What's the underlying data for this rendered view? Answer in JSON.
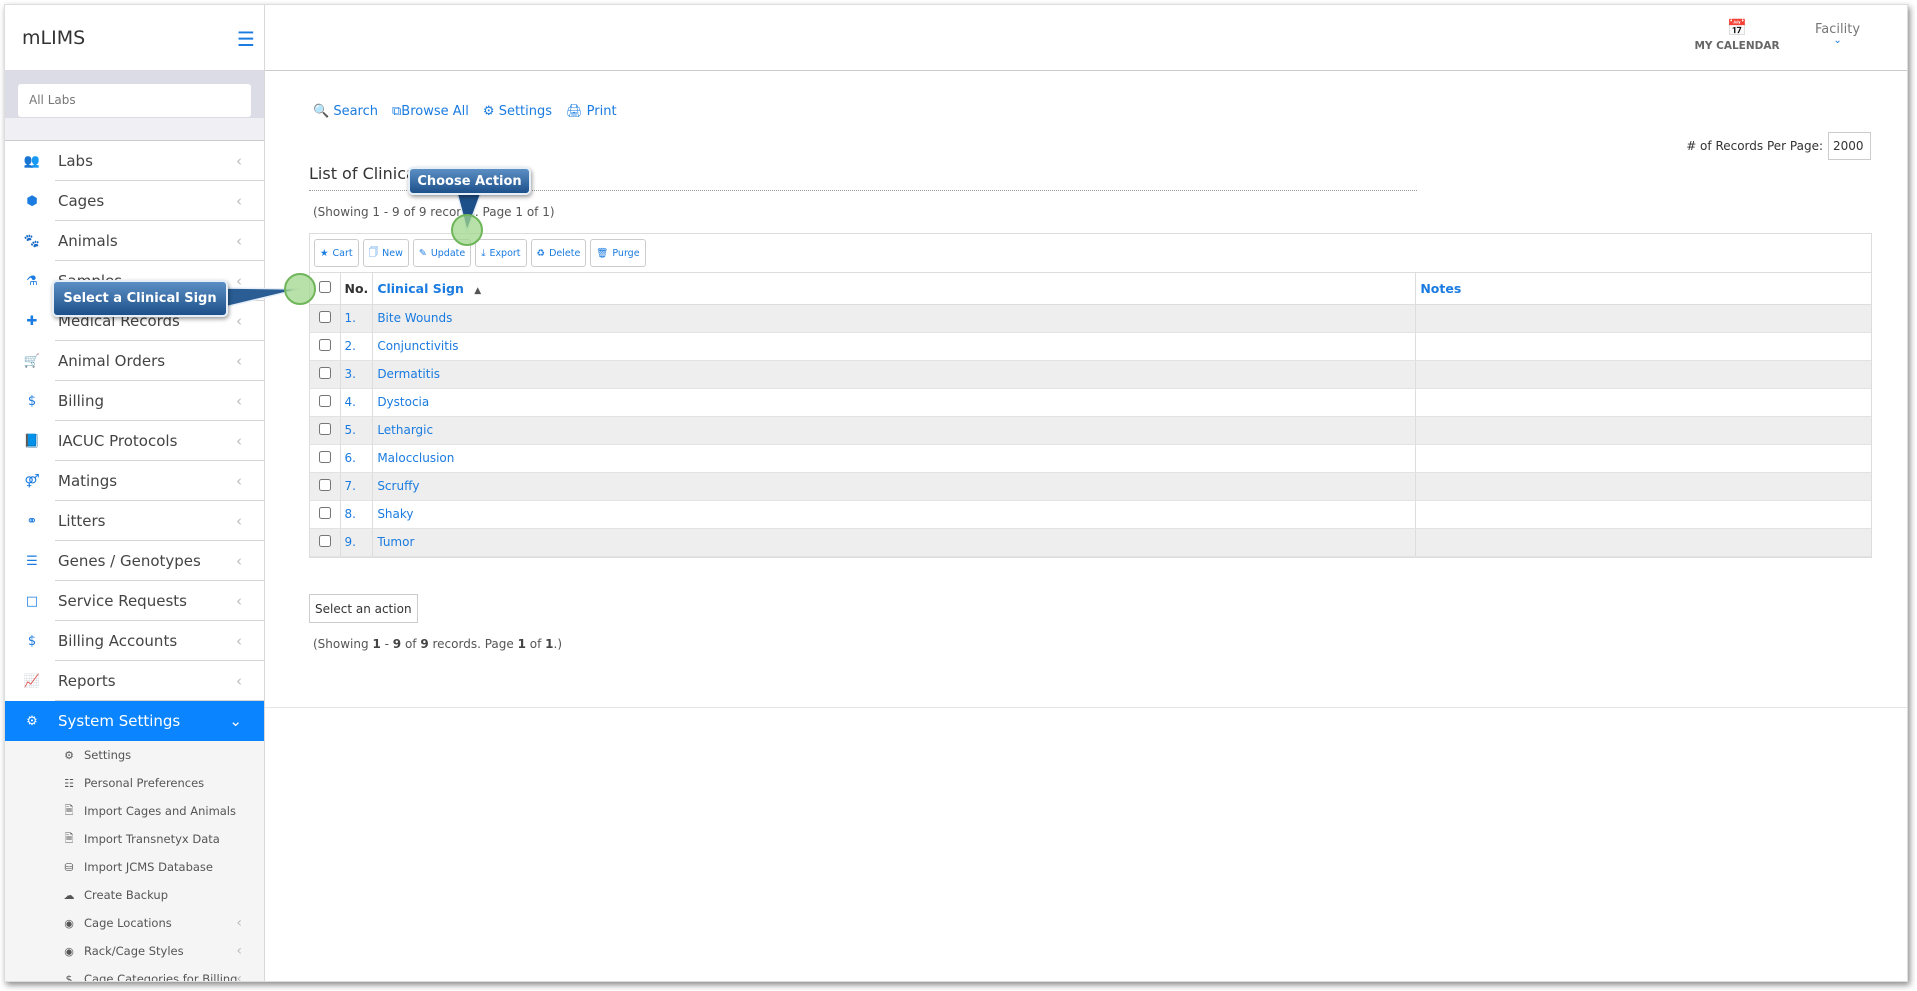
{
  "app": {
    "title": "mLIMS",
    "menu_icon": "hamburger-icon"
  },
  "sidebar": {
    "lab_selector": "All Labs",
    "items": [
      {
        "label": "Labs",
        "icon": "users-icon"
      },
      {
        "label": "Cages",
        "icon": "cube-icon"
      },
      {
        "label": "Animals",
        "icon": "paw-icon"
      },
      {
        "label": "Samples",
        "icon": "flask-icon"
      },
      {
        "label": "Medical Records",
        "icon": "medkit-icon"
      },
      {
        "label": "Animal Orders",
        "icon": "cart-icon"
      },
      {
        "label": "Billing",
        "icon": "dollar-icon"
      },
      {
        "label": "IACUC Protocols",
        "icon": "book-icon"
      },
      {
        "label": "Matings",
        "icon": "mating-icon"
      },
      {
        "label": "Litters",
        "icon": "litter-icon"
      },
      {
        "label": "Genes / Genotypes",
        "icon": "list-icon"
      },
      {
        "label": "Service Requests",
        "icon": "note-icon"
      },
      {
        "label": "Billing Accounts",
        "icon": "dollar-icon"
      },
      {
        "label": "Reports",
        "icon": "chart-icon"
      },
      {
        "label": "System Settings",
        "icon": "gear-icon",
        "active": true
      }
    ],
    "sub_items": [
      {
        "label": "Settings",
        "icon": "gear-icon"
      },
      {
        "label": "Personal Preferences",
        "icon": "sliders-icon"
      },
      {
        "label": "Import Cages and Animals",
        "icon": "excel-file-icon"
      },
      {
        "label": "Import Transnetyx Data",
        "icon": "file-icon"
      },
      {
        "label": "Import JCMS Database",
        "icon": "database-icon"
      },
      {
        "label": "Create Backup",
        "icon": "cloud-download-icon"
      },
      {
        "label": "Cage Locations",
        "icon": "dot-circle-icon"
      },
      {
        "label": "Rack/Cage Styles",
        "icon": "dot-circle-icon"
      },
      {
        "label": "Cage Categories for Billing",
        "icon": "dollar-icon"
      }
    ]
  },
  "header": {
    "calendar_label": "MY CALENDAR",
    "facility_label": "Facility"
  },
  "main": {
    "links": {
      "search": "Search",
      "browse_all": "Browse All",
      "settings": "Settings",
      "print": "Print"
    },
    "records_per_page_label": "# of Records Per Page:",
    "records_per_page": "2000",
    "title": "List of Clinical Signs",
    "showing_top": "(Showing 1 - 9 of 9 records. Page 1 of 1)",
    "toolbar": {
      "cart": "Cart",
      "new": "New",
      "update": "Update",
      "export": "Export",
      "delete": "Delete",
      "purge": "Purge"
    },
    "columns": {
      "no": "No.",
      "clinical_sign": "Clinical Sign",
      "notes": "Notes"
    },
    "rows": [
      {
        "no": "1.",
        "sign": "Bite Wounds",
        "notes": ""
      },
      {
        "no": "2.",
        "sign": "Conjunctivitis",
        "notes": ""
      },
      {
        "no": "3.",
        "sign": "Dermatitis",
        "notes": ""
      },
      {
        "no": "4.",
        "sign": "Dystocia",
        "notes": ""
      },
      {
        "no": "5.",
        "sign": "Lethargic",
        "notes": ""
      },
      {
        "no": "6.",
        "sign": "Malocclusion",
        "notes": ""
      },
      {
        "no": "7.",
        "sign": "Scruffy",
        "notes": ""
      },
      {
        "no": "8.",
        "sign": "Shaky",
        "notes": ""
      },
      {
        "no": "9.",
        "sign": "Tumor",
        "notes": ""
      }
    ],
    "action_select": "Select an action",
    "showing_bottom": {
      "prefix": "(Showing ",
      "from": "1",
      "dash": " - ",
      "to": "9",
      "of": " of ",
      "total": "9",
      "records": " records. Page ",
      "page": "1",
      "of2": " of ",
      "pages": "1",
      "suffix": ".)"
    }
  },
  "callouts": {
    "choose_action": "Choose Action",
    "select_sign": "Select a Clinical Sign"
  },
  "colors": {
    "accent": "#1a7be0",
    "active_nav": "#0a84ff",
    "callout": "#1d5089",
    "marker": "#a0d78c"
  }
}
